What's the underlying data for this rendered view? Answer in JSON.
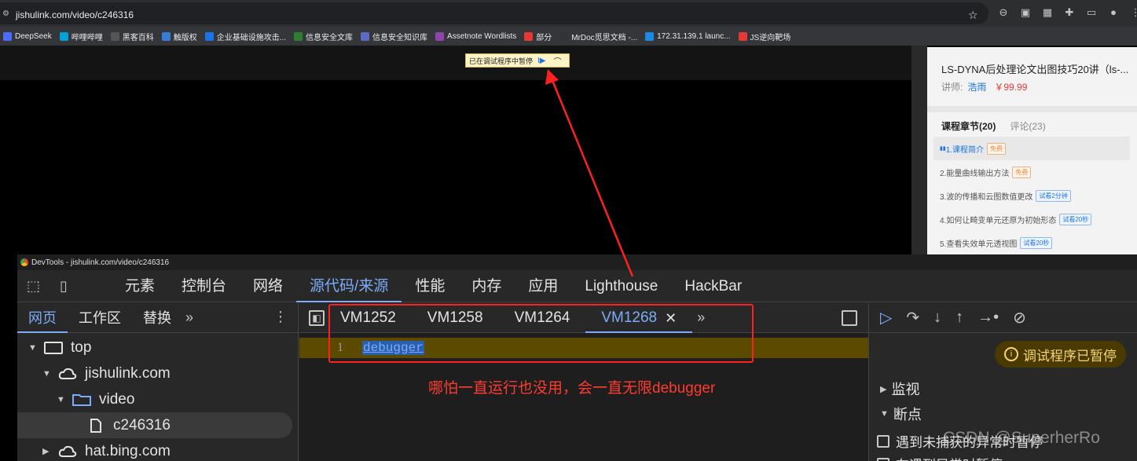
{
  "browser": {
    "url": "jishulink.com/video/c246316",
    "bookmarks": [
      {
        "label": "DeepSeek",
        "color": "#4d6bfe"
      },
      {
        "label": "哔哩哔哩",
        "color": "#00a1d6"
      },
      {
        "label": "黑客百科",
        "color": "#555555"
      },
      {
        "label": "触版权",
        "color": "#3a7bd5"
      },
      {
        "label": "企业基础设施攻击...",
        "color": "#1a73e8"
      },
      {
        "label": "信息安全文库",
        "color": "#2e7d32"
      },
      {
        "label": "信息安全知识库",
        "color": "#5c6bc0"
      },
      {
        "label": "Assetnote Wordlists",
        "color": "#8e44ad"
      },
      {
        "label": "部分",
        "color": "#e53935"
      },
      {
        "label": "MrDoc觅思文档 -...",
        "color": "#333333"
      },
      {
        "label": "172.31.139.1 launc...",
        "color": "#1e88e5"
      },
      {
        "label": "JS逆向靶场",
        "color": "#e53935"
      }
    ]
  },
  "pause_banner": {
    "text": "已在调试程序中暂停",
    "resume_glyph": "I▶",
    "step_glyph": "⌒"
  },
  "course": {
    "title": "LS-DYNA后处理论文出图技巧20讲（ls-...",
    "teacher_label": "讲师:",
    "teacher": "浩雨",
    "price": "￥99.99",
    "tab_chapters": "课程章节(20)",
    "tab_comments": "评论(23)",
    "chapters": [
      {
        "label": "1.课程简介",
        "tag": "免费",
        "tag_type": "free",
        "active": true
      },
      {
        "label": "2.能量曲线输出方法",
        "tag": "免费",
        "tag_type": "free",
        "active": false
      },
      {
        "label": "3.波的传播和云图数值更改",
        "tag": "试看2分钟",
        "tag_type": "trial",
        "active": false
      },
      {
        "label": "4.如何让畸变单元还原为初始形态",
        "tag": "试看20秒",
        "tag_type": "trial",
        "active": false
      },
      {
        "label": "5.查看失效单元透视图",
        "tag": "试看20秒",
        "tag_type": "trial",
        "active": false
      }
    ]
  },
  "devtools": {
    "title": "DevTools - jishulink.com/video/c246316",
    "tabs": [
      "元素",
      "控制台",
      "网络",
      "源代码/来源",
      "性能",
      "内存",
      "应用",
      "Lighthouse",
      "HackBar"
    ],
    "active_tab": "源代码/来源",
    "left_tabs": [
      "网页",
      "工作区",
      "替换"
    ],
    "tree": [
      {
        "label": "top",
        "indent": 0,
        "arrow": "▼",
        "icon": "frame"
      },
      {
        "label": "jishulink.com",
        "indent": 1,
        "arrow": "▼",
        "icon": "cloud"
      },
      {
        "label": "video",
        "indent": 2,
        "arrow": "▼",
        "icon": "folder"
      },
      {
        "label": "c246316",
        "indent": 3,
        "arrow": "",
        "icon": "file",
        "selected": true
      },
      {
        "label": "hat.bing.com",
        "indent": 1,
        "arrow": "▶",
        "icon": "cloud"
      }
    ],
    "editor_tabs": [
      "VM1252",
      "VM1258",
      "VM1264",
      "VM1268"
    ],
    "active_editor_tab": "VM1268",
    "line_number": "1",
    "code": "debugger",
    "paused_label": "调试程序已暂停",
    "sections": [
      "监视",
      "断点"
    ],
    "checkboxes": [
      "遇到未捕获的异常时暂停",
      "在遇到异常时暂停"
    ]
  },
  "annotation": "哪怕一直运行也没用，会一直无限debugger",
  "watermark": "CSDN @SuperherRo",
  "colors": {
    "annotation_red": "#ff2020",
    "devtools_accent": "#7cacf8"
  }
}
